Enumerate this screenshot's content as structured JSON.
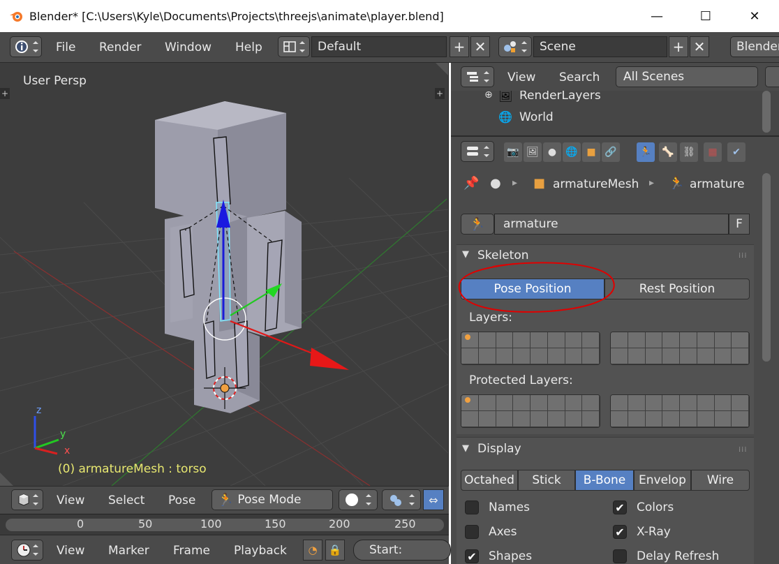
{
  "window": {
    "title": "Blender* [C:\\Users\\Kyle\\Documents\\Projects\\threejs\\animate\\player.blend]",
    "minimize_glyph": "—",
    "maximize_glyph": "☐",
    "close_glyph": "✕"
  },
  "menubar": {
    "items": [
      "File",
      "Render",
      "Window",
      "Help"
    ],
    "screen_layout": "Default",
    "scene": "Scene",
    "engine": "Blender"
  },
  "viewport": {
    "view_label": "User Persp",
    "status": "(0) armatureMesh : torso",
    "axis_x": "x",
    "axis_y": "y",
    "axis_z": "z"
  },
  "viewport_header": {
    "items": [
      "View",
      "Select",
      "Pose"
    ],
    "mode": "Pose Mode"
  },
  "timeline": {
    "ruler": [
      "0",
      "50",
      "100",
      "150",
      "200",
      "250"
    ],
    "items": [
      "View",
      "Marker",
      "Frame",
      "Playback"
    ],
    "start_label": "Start:"
  },
  "outliner": {
    "header_items": [
      "View",
      "Search"
    ],
    "filter": "All Scenes",
    "rows": [
      "RenderLayers",
      "World"
    ]
  },
  "properties": {
    "breadcrumb": [
      "armatureMesh",
      "armature"
    ],
    "datablock_name": "armature",
    "fake_user": "F",
    "skeleton": {
      "title": "Skeleton",
      "pose_position": "Pose Position",
      "rest_position": "Rest Position",
      "layers_label": "Layers:",
      "protected_layers_label": "Protected Layers:"
    },
    "display": {
      "title": "Display",
      "draw_types": [
        "Octahed",
        "Stick",
        "B-Bone",
        "Envelop",
        "Wire"
      ],
      "active_draw_type": "B-Bone",
      "options": [
        {
          "label": "Names",
          "checked": false
        },
        {
          "label": "Colors",
          "checked": true
        },
        {
          "label": "Axes",
          "checked": false
        },
        {
          "label": "X-Ray",
          "checked": true
        },
        {
          "label": "Shapes",
          "checked": true
        },
        {
          "label": "Delay Refresh",
          "checked": false
        }
      ]
    }
  },
  "colors": {
    "accent": "#5680c2",
    "annotation": "#e00000",
    "status_text": "#e8e870"
  }
}
